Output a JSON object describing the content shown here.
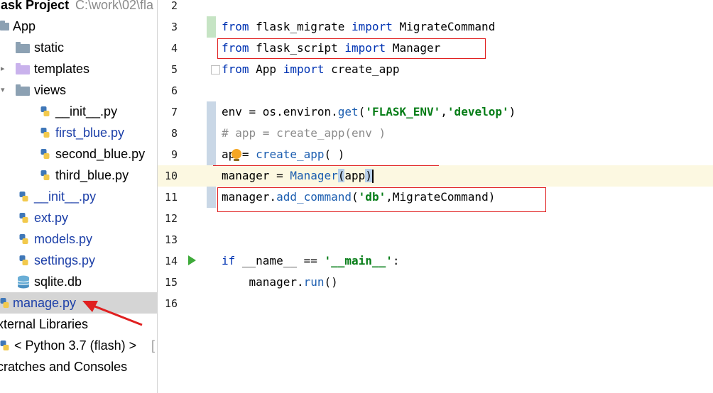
{
  "project_tree": {
    "root": {
      "label": "lask Project",
      "path": "C:\\work\\02\\fla"
    },
    "items": [
      {
        "label": "App",
        "kind": "folder"
      },
      {
        "label": "static",
        "kind": "folder"
      },
      {
        "label": "templates",
        "kind": "folder"
      },
      {
        "label": "views",
        "kind": "folder"
      },
      {
        "label": "__init__.py",
        "kind": "python"
      },
      {
        "label": "first_blue.py",
        "kind": "python"
      },
      {
        "label": "second_blue.py",
        "kind": "python"
      },
      {
        "label": "third_blue.py",
        "kind": "python"
      },
      {
        "label": "__init__.py",
        "kind": "python"
      },
      {
        "label": "ext.py",
        "kind": "python"
      },
      {
        "label": "models.py",
        "kind": "python"
      },
      {
        "label": "settings.py",
        "kind": "python"
      },
      {
        "label": "sqlite.db",
        "kind": "database"
      },
      {
        "label": "manage.py",
        "kind": "python",
        "selected": true
      },
      {
        "label": "xternal Libraries",
        "kind": "library"
      },
      {
        "label": "< Python 3.7 (flash) >",
        "suffix": "[",
        "kind": "python"
      },
      {
        "label": "cratches and Consoles",
        "kind": "scratch"
      }
    ]
  },
  "editor": {
    "line_numbers": [
      "2",
      "3",
      "4",
      "5",
      "6",
      "7",
      "8",
      "9",
      "10",
      "11",
      "12",
      "13",
      "14",
      "15",
      "16"
    ],
    "lines": {
      "l3": {
        "kw1": "from",
        "mod": " flask_migrate ",
        "kw2": "import",
        "name": " MigrateCommand"
      },
      "l4": {
        "kw1": "from",
        "mod": " flask_script ",
        "kw2": "import",
        "name": " Manager"
      },
      "l5": {
        "kw1": "from",
        "mod": " App ",
        "kw2": "import",
        "name": " create_app"
      },
      "l7": {
        "a": "env = os.environ.",
        "fn": "get",
        "b": "(",
        "s1": "'FLASK_ENV'",
        "c": ",",
        "s2": "'develop'",
        "d": ")"
      },
      "l8": {
        "comment": "# app = create_app(env )"
      },
      "l9": {
        "a": "ap",
        "b": " = ",
        "fn": "create_app",
        "c": "( )"
      },
      "l10": {
        "a": "manager = ",
        "fn": "Manager",
        "b": "(",
        "c": "app",
        "d": ")"
      },
      "l11": {
        "a": "manager.",
        "fn": "add_command",
        "b": "(",
        "s1": "'db'",
        "c": ",MigrateCommand)"
      },
      "l14": {
        "kw": "if",
        "a": " __name__ == ",
        "s1": "'__main__'",
        "b": ":"
      },
      "l15": {
        "a": "    manager.",
        "fn": "run",
        "b": "()"
      }
    }
  },
  "colors": {
    "keyword": "#0033b3",
    "string": "#067d17",
    "comment": "#8c8c8c",
    "annotation_red": "#e02020",
    "current_line": "#fcf8e1",
    "selected_row": "#d5d5d5"
  }
}
